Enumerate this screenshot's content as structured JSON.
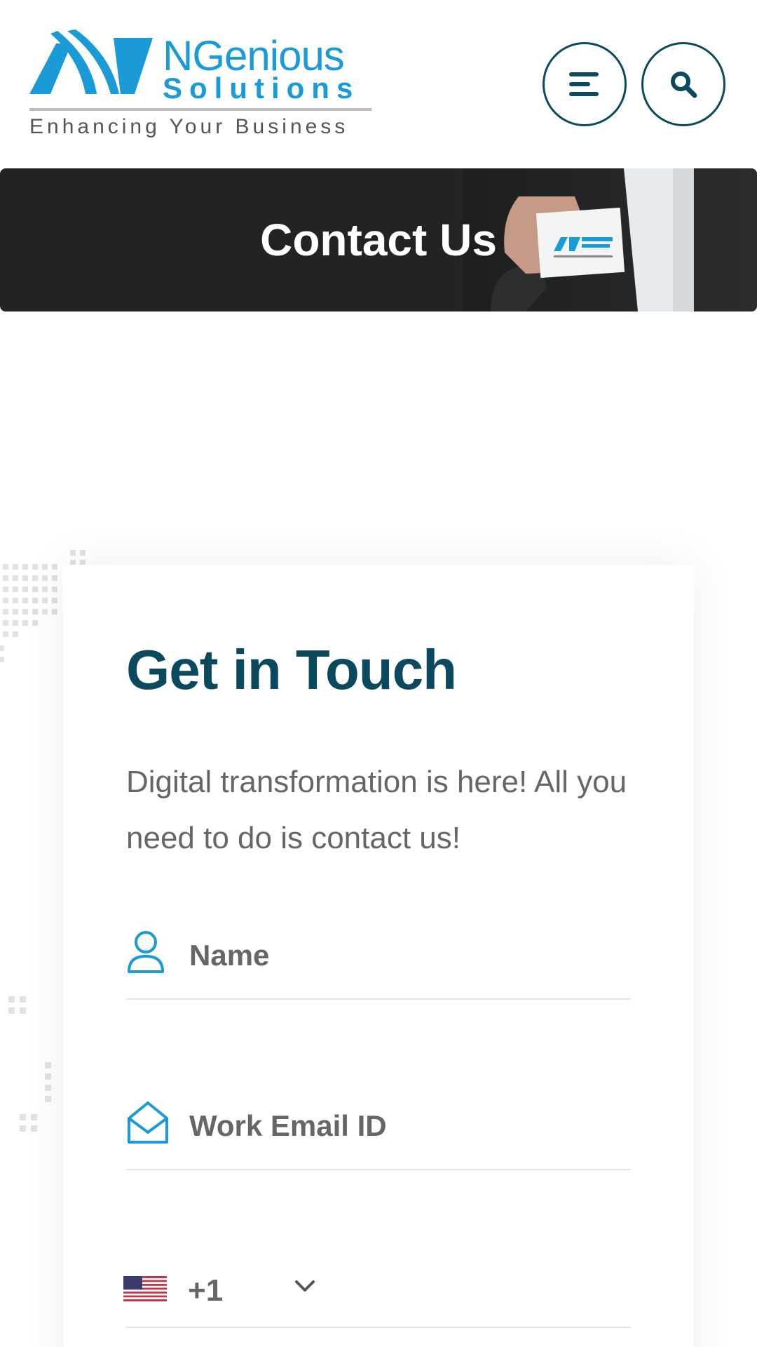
{
  "header": {
    "logo": {
      "title": "NGenious",
      "subtitle": "Solutions",
      "tagline": "Enhancing Your Business"
    },
    "menu_icon": "hamburger-menu-icon",
    "search_icon": "search-icon"
  },
  "banner": {
    "title": "Contact Us"
  },
  "form": {
    "title": "Get in Touch",
    "description": "Digital transformation is here! All you need to do is contact us!",
    "fields": {
      "name": {
        "placeholder": "Name",
        "icon": "user-icon"
      },
      "email": {
        "placeholder": "Work Email ID",
        "icon": "envelope-icon"
      },
      "phone": {
        "country_code": "+1",
        "flag": "us-flag-icon"
      }
    }
  },
  "colors": {
    "brand_blue": "#1a9ad7",
    "dark_teal": "#0b4a5e",
    "banner_bg": "#222424"
  }
}
